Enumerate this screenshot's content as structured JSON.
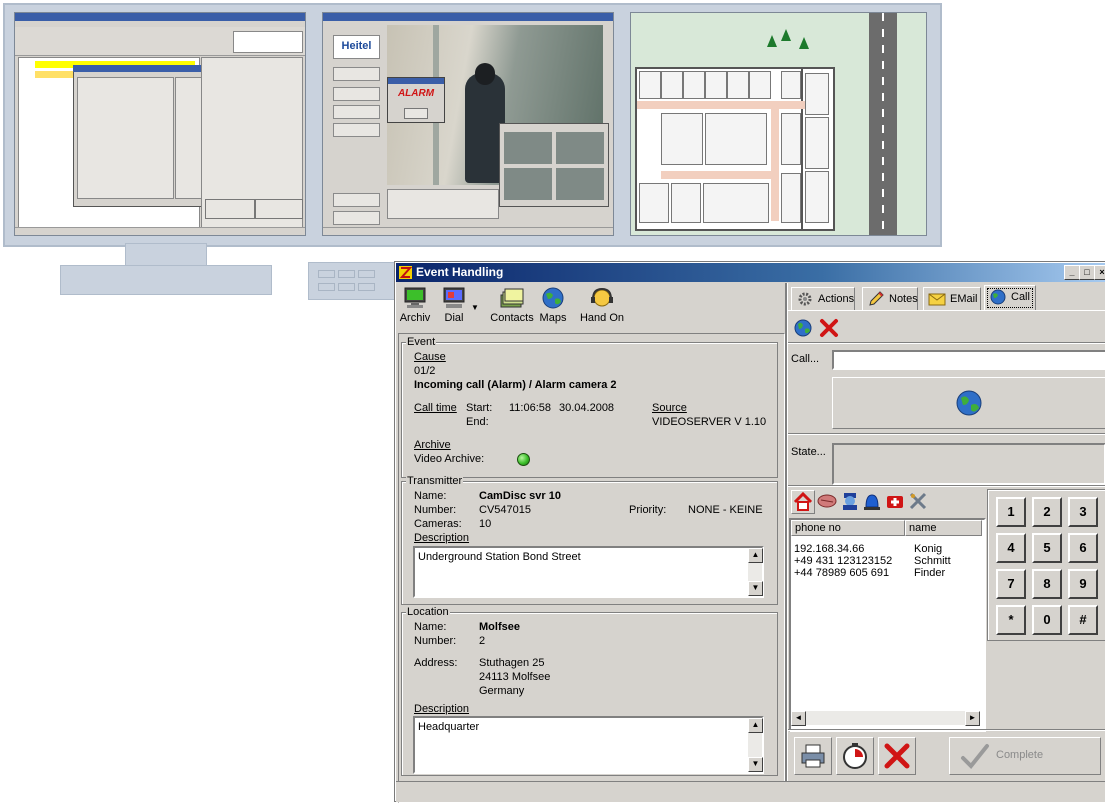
{
  "window": {
    "title": "Event Handling"
  },
  "toolbar": {
    "archiv": "Archiv",
    "dial": "Dial",
    "contacts": "Contacts",
    "maps": "Maps",
    "hand_on": "Hand On"
  },
  "event": {
    "group_label": "Event",
    "cause_label": "Cause",
    "cause_code": "01/2",
    "cause_text": "Incoming call (Alarm) / Alarm camera 2",
    "call_time_label": "Call time",
    "start_label": "Start:",
    "start_time": "11:06:58",
    "start_date": "30.04.2008",
    "end_label": "End:",
    "source_label": "Source",
    "source_value": "VIDEOSERVER V 1.10",
    "archive_label": "Archive",
    "video_archive_label": "Video Archive:"
  },
  "transmitter": {
    "group_label": "Transmitter",
    "name_label": "Name:",
    "name_value": "CamDisc svr 10",
    "number_label": "Number:",
    "number_value": "CV547015",
    "priority_label": "Priority:",
    "priority_value": "NONE - KEINE",
    "cameras_label": "Cameras:",
    "cameras_value": "10",
    "description_label": "Description",
    "description_text": "Underground Station Bond Street"
  },
  "location": {
    "group_label": "Location",
    "name_label": "Name:",
    "name_value": "Molfsee",
    "number_label": "Number:",
    "number_value": "2",
    "address_label": "Address:",
    "address_line1": "Stuthagen 25",
    "address_line2": "24113 Molfsee",
    "address_line3": "Germany",
    "description_label": "Description",
    "description_text": "Headquarter"
  },
  "tabs": [
    {
      "label": "Actions",
      "icon": "gear-icon"
    },
    {
      "label": "Notes",
      "icon": "pencil-icon"
    },
    {
      "label": "EMail",
      "icon": "envelope-icon"
    },
    {
      "label": "Call",
      "icon": "globe-icon"
    }
  ],
  "call": {
    "call_label": "Call...",
    "call_value": "",
    "state_label": "State..."
  },
  "phonebook": {
    "col_phone": "phone no",
    "col_name": "name",
    "rows": [
      {
        "phone": "192.168.34.66",
        "name": "Konig"
      },
      {
        "phone": "+49 431 123123152",
        "name": "Schmitt"
      },
      {
        "phone": "+44 78989 605 691",
        "name": "Finder"
      }
    ]
  },
  "keypad": [
    "1",
    "2",
    "3",
    "4",
    "5",
    "6",
    "7",
    "8",
    "9",
    "*",
    "0",
    "#"
  ],
  "complete_label": "Complete",
  "background": {
    "logo": "Heitel",
    "alarm_text": "ALARM"
  },
  "colors": {
    "title_start": "#0a246a",
    "title_end": "#a6caf0",
    "window_bg": "#d6d3ce",
    "led_green": "#3cbf2a",
    "red_x": "#d01515"
  }
}
